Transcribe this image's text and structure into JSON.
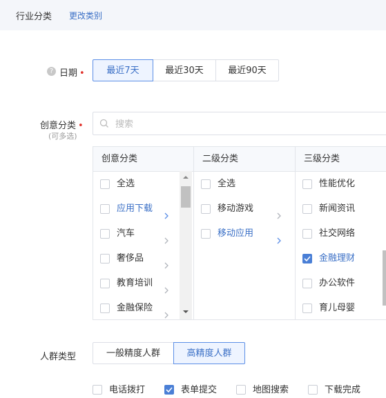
{
  "header": {
    "title": "行业分类",
    "change_link": "更改类别"
  },
  "date": {
    "label": "日期",
    "options": [
      {
        "label": "最近7天",
        "active": true
      },
      {
        "label": "最近30天",
        "active": false
      },
      {
        "label": "最近90天",
        "active": false
      }
    ]
  },
  "creative": {
    "label": "创意分类",
    "sub_label": "(可多选)",
    "search_placeholder": "搜索",
    "columns": [
      {
        "header": "创意分类",
        "items": [
          {
            "label": "全选",
            "checked": false,
            "arrow": false,
            "highlighted": false
          },
          {
            "label": "应用下载",
            "checked": false,
            "arrow": true,
            "highlighted": true
          },
          {
            "label": "汽车",
            "checked": false,
            "arrow": true,
            "highlighted": false
          },
          {
            "label": "奢侈品",
            "checked": false,
            "arrow": true,
            "highlighted": false
          },
          {
            "label": "教育培训",
            "checked": false,
            "arrow": true,
            "highlighted": false
          },
          {
            "label": "金融保险",
            "checked": false,
            "arrow": true,
            "highlighted": false
          }
        ]
      },
      {
        "header": "二级分类",
        "items": [
          {
            "label": "全选",
            "checked": false,
            "arrow": false,
            "highlighted": false
          },
          {
            "label": "移动游戏",
            "checked": false,
            "arrow": true,
            "highlighted": false
          },
          {
            "label": "移动应用",
            "checked": false,
            "arrow": true,
            "highlighted": true
          }
        ]
      },
      {
        "header": "三级分类",
        "items": [
          {
            "label": "性能优化",
            "checked": false,
            "arrow": false,
            "highlighted": false
          },
          {
            "label": "新闻资讯",
            "checked": false,
            "arrow": false,
            "highlighted": false
          },
          {
            "label": "社交网络",
            "checked": false,
            "arrow": false,
            "highlighted": false
          },
          {
            "label": "金融理财",
            "checked": true,
            "arrow": false,
            "highlighted": true
          },
          {
            "label": "办公软件",
            "checked": false,
            "arrow": false,
            "highlighted": false
          },
          {
            "label": "育儿母婴",
            "checked": false,
            "arrow": false,
            "highlighted": false
          }
        ]
      }
    ]
  },
  "audience": {
    "label": "人群类型",
    "options": [
      {
        "label": "一般精度人群",
        "active": false
      },
      {
        "label": "高精度人群",
        "active": true
      }
    ]
  },
  "conversions": [
    {
      "label": "电话拨打",
      "checked": false
    },
    {
      "label": "表单提交",
      "checked": true
    },
    {
      "label": "地图搜索",
      "checked": false
    },
    {
      "label": "下载完成",
      "checked": false
    }
  ],
  "colors": {
    "accent": "#3a6fc6",
    "checked_bg": "#4a7fd6",
    "required": "#e0312b"
  }
}
